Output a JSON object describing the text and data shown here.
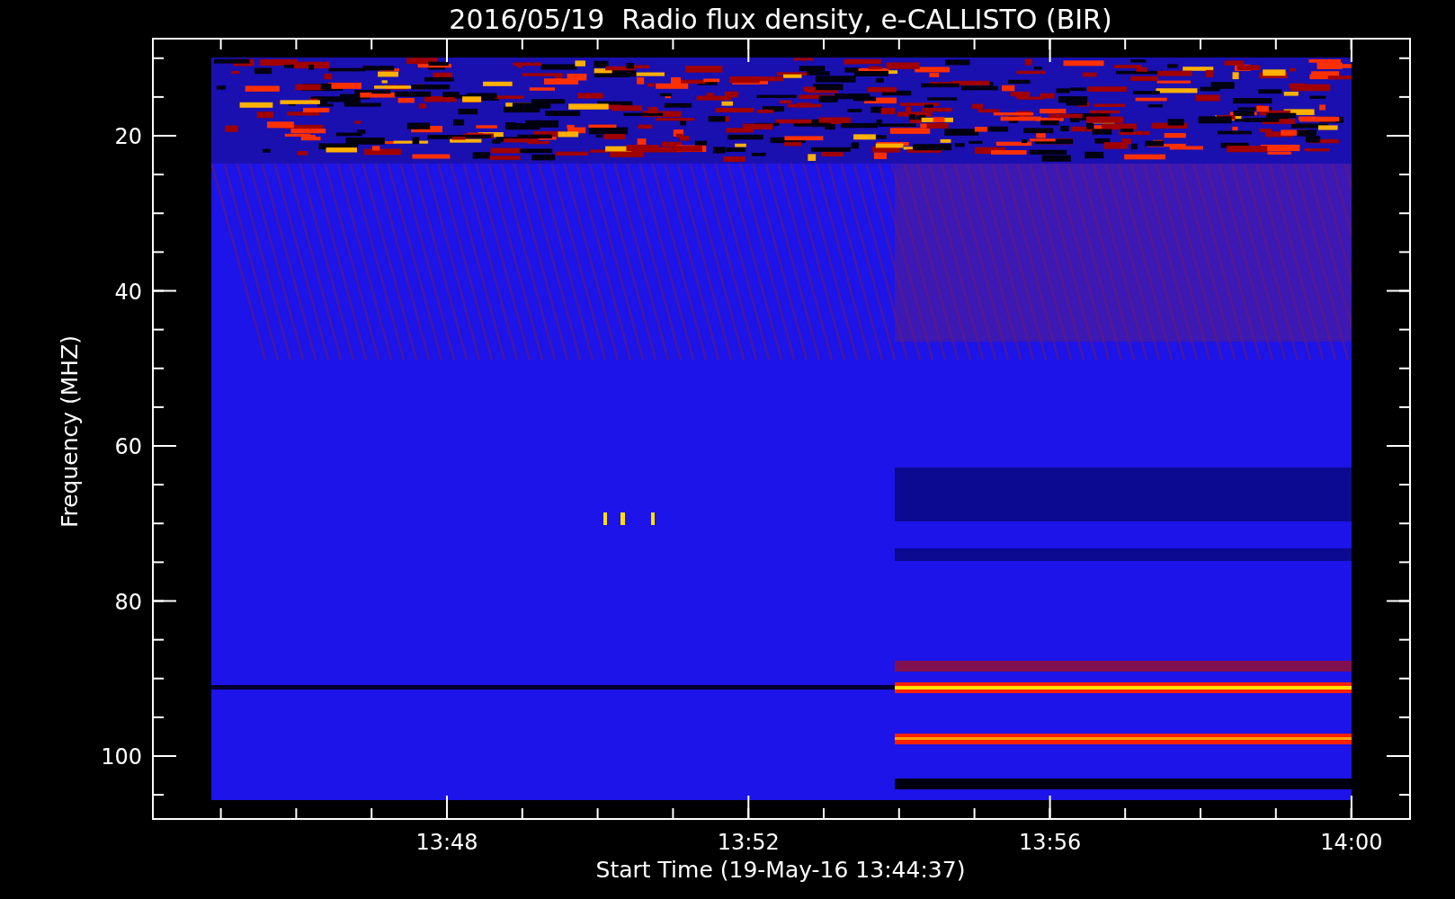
{
  "title": "2016/05/19  Radio flux density, e-CALLISTO (BIR)",
  "y_axis": {
    "label": "Frequency (MHZ)",
    "ticks": [
      "20",
      "40",
      "60",
      "80",
      "100"
    ]
  },
  "x_axis": {
    "label": "Start Time (19-May-16 13:44:37)",
    "ticks": [
      "13:48",
      "13:52",
      "13:56",
      "14:00"
    ]
  }
}
